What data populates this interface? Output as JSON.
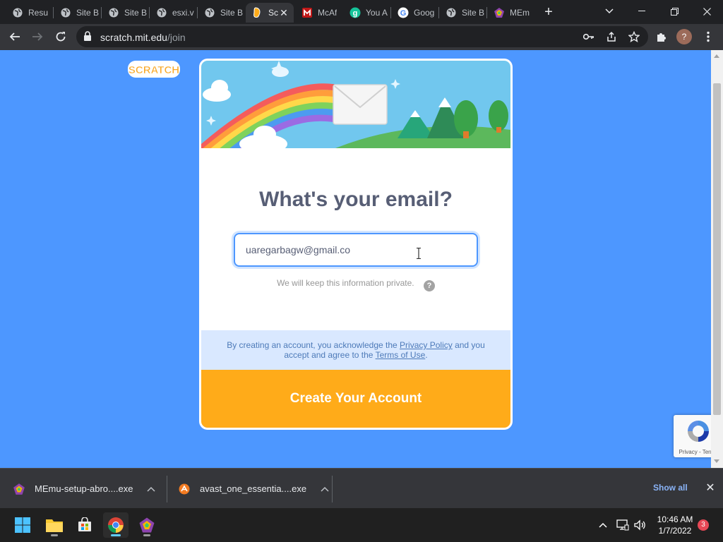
{
  "browser": {
    "tabs": [
      {
        "label": "Resu",
        "icon": "globe-icon"
      },
      {
        "label": "Site B",
        "icon": "globe-icon"
      },
      {
        "label": "Site B",
        "icon": "globe-icon"
      },
      {
        "label": "esxi.v",
        "icon": "globe-icon"
      },
      {
        "label": "Site B",
        "icon": "globe-icon"
      },
      {
        "label": "Sc",
        "icon": "scratch-cat-icon"
      },
      {
        "label": "McAf",
        "icon": "mcafee-icon"
      },
      {
        "label": "You A",
        "icon": "grammarly-icon"
      },
      {
        "label": "Goog",
        "icon": "google-icon"
      },
      {
        "label": "Site B",
        "icon": "globe-icon"
      },
      {
        "label": "MEm",
        "icon": "memu-icon"
      }
    ],
    "active_tab_index": 5,
    "new_tab_symbol": "+",
    "url_host": "scratch.mit.edu",
    "url_path": "/join",
    "profile_initial": "?"
  },
  "page": {
    "logo_text": "SCRATCH",
    "title": "What's your email?",
    "email_value": "uaregarbagw@gmail.co",
    "privacy_note": "We will keep this information private.",
    "help_symbol": "?",
    "terms": {
      "part1": "By creating an account, you acknowledge the ",
      "privacy_link": "Privacy Policy",
      "part2": " and you accept and agree to the ",
      "terms_link": "Terms of Use",
      "part3": "."
    },
    "create_button": "Create Your Account",
    "recaptcha_label": "Privacy - Terms"
  },
  "downloads": {
    "items": [
      {
        "name": "MEmu-setup-abro....exe",
        "icon": "memu-icon"
      },
      {
        "name": "avast_one_essentia....exe",
        "icon": "avast-icon"
      }
    ],
    "show_all": "Show all"
  },
  "taskbar": {
    "time": "10:46 AM",
    "date": "1/7/2022",
    "notification_count": "3"
  },
  "colors": {
    "page_bg": "#4d97ff",
    "button_orange": "#ffab19",
    "title_gray": "#575e75",
    "terms_bg": "#d9e8ff"
  }
}
